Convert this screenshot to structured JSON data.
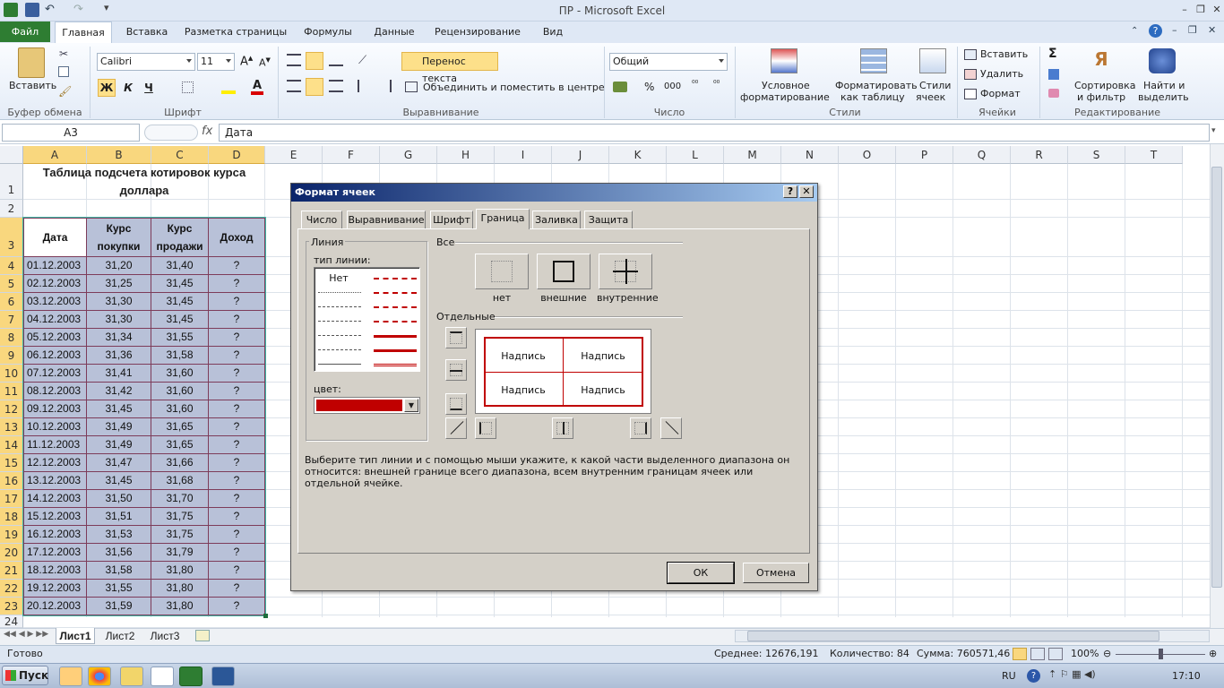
{
  "window": {
    "title": "ПР - Microsoft Excel"
  },
  "ribbon": {
    "file_tab": "Файл",
    "tabs": [
      "Главная",
      "Вставка",
      "Разметка страницы",
      "Формулы",
      "Данные",
      "Рецензирование",
      "Вид"
    ],
    "clipboard": {
      "paste": "Вставить",
      "group": "Буфер обмена"
    },
    "font": {
      "name": "Calibri",
      "size": "11",
      "bold": "Ж",
      "italic": "К",
      "underline": "Ч",
      "group": "Шрифт"
    },
    "alignment": {
      "wrap": "Перенос текста",
      "merge": "Объединить и поместить в центре",
      "group": "Выравнивание"
    },
    "number": {
      "format": "Общий",
      "group": "Число"
    },
    "styles": {
      "conditional_1": "Условное",
      "conditional_2": "форматирование",
      "as_table_1": "Форматировать",
      "as_table_2": "как таблицу",
      "cell_styles_1": "Стили",
      "cell_styles_2": "ячеек",
      "group": "Стили"
    },
    "cells": {
      "insert": "Вставить",
      "delete": "Удалить",
      "format": "Формат",
      "group": "Ячейки"
    },
    "editing": {
      "sort_1": "Сортировка",
      "sort_2": "и фильтр",
      "find_1": "Найти и",
      "find_2": "выделить",
      "group": "Редактирование"
    }
  },
  "formula_bar": {
    "name_box": "A3",
    "fx": "fx",
    "value": "Дата"
  },
  "columns": [
    "A",
    "B",
    "C",
    "D",
    "E",
    "F",
    "G",
    "H",
    "I",
    "J",
    "K",
    "L",
    "M",
    "N",
    "O",
    "P",
    "Q",
    "R",
    "S",
    "T"
  ],
  "sheet": {
    "title_line1": "Таблица подсчета котировок курса",
    "title_line2": "доллара",
    "headers": {
      "date": "Дата",
      "buy_1": "Курс",
      "buy_2": "покупки",
      "sell_1": "Курс",
      "sell_2": "продажи",
      "income": "Доход"
    },
    "rows": [
      [
        "01.12.2003",
        "31,20",
        "31,40",
        "?"
      ],
      [
        "02.12.2003",
        "31,25",
        "31,45",
        "?"
      ],
      [
        "03.12.2003",
        "31,30",
        "31,45",
        "?"
      ],
      [
        "04.12.2003",
        "31,30",
        "31,45",
        "?"
      ],
      [
        "05.12.2003",
        "31,34",
        "31,55",
        "?"
      ],
      [
        "06.12.2003",
        "31,36",
        "31,58",
        "?"
      ],
      [
        "07.12.2003",
        "31,41",
        "31,60",
        "?"
      ],
      [
        "08.12.2003",
        "31,42",
        "31,60",
        "?"
      ],
      [
        "09.12.2003",
        "31,45",
        "31,60",
        "?"
      ],
      [
        "10.12.2003",
        "31,49",
        "31,65",
        "?"
      ],
      [
        "11.12.2003",
        "31,49",
        "31,65",
        "?"
      ],
      [
        "12.12.2003",
        "31,47",
        "31,66",
        "?"
      ],
      [
        "13.12.2003",
        "31,45",
        "31,68",
        "?"
      ],
      [
        "14.12.2003",
        "31,50",
        "31,70",
        "?"
      ],
      [
        "15.12.2003",
        "31,51",
        "31,75",
        "?"
      ],
      [
        "16.12.2003",
        "31,53",
        "31,75",
        "?"
      ],
      [
        "17.12.2003",
        "31,56",
        "31,79",
        "?"
      ],
      [
        "18.12.2003",
        "31,58",
        "31,80",
        "?"
      ],
      [
        "19.12.2003",
        "31,55",
        "31,80",
        "?"
      ],
      [
        "20.12.2003",
        "31,59",
        "31,80",
        "?"
      ]
    ]
  },
  "sheet_tabs": [
    "Лист1",
    "Лист2",
    "Лист3"
  ],
  "status": {
    "ready": "Готово",
    "average": "Среднее: 12676,191",
    "count": "Количество: 84",
    "sum": "Сумма: 760571,46",
    "zoom": "100%"
  },
  "taskbar": {
    "start": "Пуск",
    "lang": "RU",
    "time": "17:10"
  },
  "dialog": {
    "title": "Формат ячеек",
    "help": "?",
    "close": "✕",
    "tabs": [
      "Число",
      "Выравнивание",
      "Шрифт",
      "Граница",
      "Заливка",
      "Защита"
    ],
    "active_tab": "Граница",
    "line_group": "Линия",
    "line_type_label": "тип линии:",
    "none_style": "Нет",
    "color_label": "цвет:",
    "line_color": "#c00000",
    "all_label": "Все",
    "presets": [
      "нет",
      "внешние",
      "внутренние"
    ],
    "individual_label": "Отдельные",
    "preview_texts": [
      "Надпись",
      "Надпись",
      "Надпись",
      "Надпись"
    ],
    "hint": "Выберите тип линии и с помощью мыши укажите, к какой части выделенного диапазона он относится: внешней границе всего диапазона, всем внутренним границам ячеек или отдельной ячейке.",
    "ok": "ОК",
    "cancel": "Отмена"
  },
  "colors": {
    "accent_green": "#2e7d32",
    "table_fill": "#b8c1d8",
    "table_border": "#7d3c5a",
    "border_red": "#c00000"
  }
}
